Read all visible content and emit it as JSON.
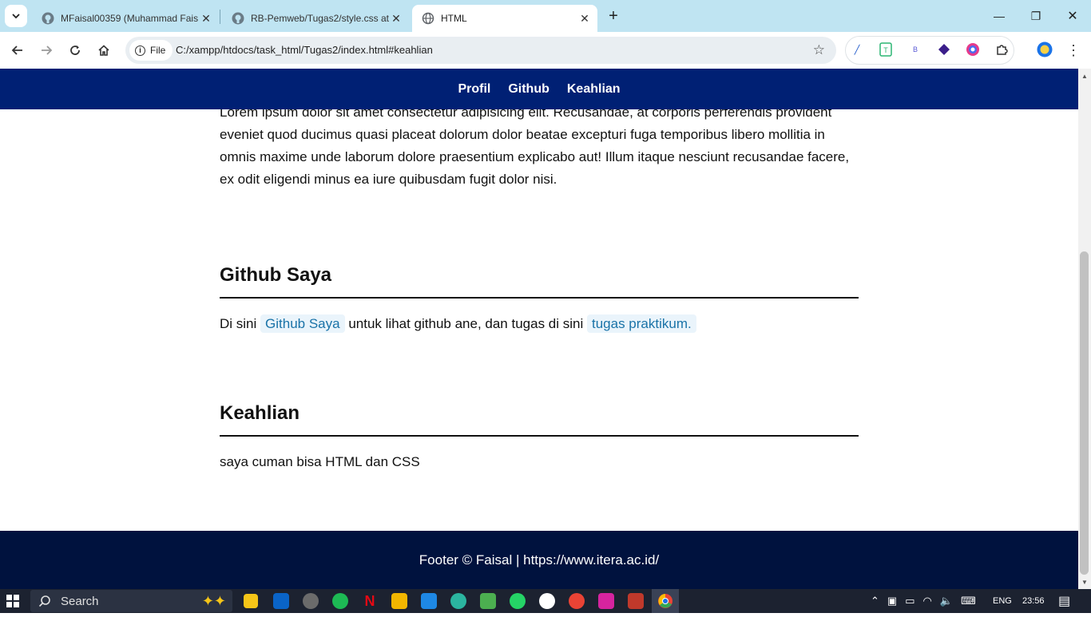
{
  "browser": {
    "tabs": [
      {
        "title": "MFaisal00359 (Muhammad Fais",
        "active": false,
        "icon": "github-icon"
      },
      {
        "title": "RB-Pemweb/Tugas2/style.css at",
        "active": false,
        "icon": "github-icon"
      },
      {
        "title": "HTML",
        "active": true,
        "icon": "globe-icon"
      }
    ],
    "address": {
      "scheme_chip": "File",
      "url": "C:/xampp/htdocs/task_html/Tugas2/index.html#keahlian"
    }
  },
  "site": {
    "nav": [
      "Profil",
      "Github",
      "Keahlian"
    ],
    "profile_text": "Lorem ipsum dolor sit amet consectetur adipisicing elit. Recusandae, at corporis perferendis provident eveniet quod ducimus quasi placeat dolorum dolor beatae excepturi fuga temporibus libero mollitia in omnis maxime unde laborum dolore praesentium explicabo aut! Illum itaque nesciunt recusandae facere, ex odit eligendi minus ea iure quibusdam fugit dolor nisi.",
    "github": {
      "heading": "Github Saya",
      "text_before": "Di sini",
      "link1": "Github Saya",
      "text_middle": "untuk lihat github ane, dan tugas di sini",
      "link2": "tugas praktikum."
    },
    "keahlian": {
      "heading": "Keahlian",
      "text": "saya cuman bisa HTML dan CSS"
    },
    "footer": "Footer © Faisal | https://www.itera.ac.id/"
  },
  "taskbar": {
    "search_label": "Search",
    "language": "ENG",
    "time": "23:56"
  },
  "colors": {
    "nav_bg": "#002074",
    "footer_bg": "#00123e",
    "link": "#1a73a8"
  }
}
